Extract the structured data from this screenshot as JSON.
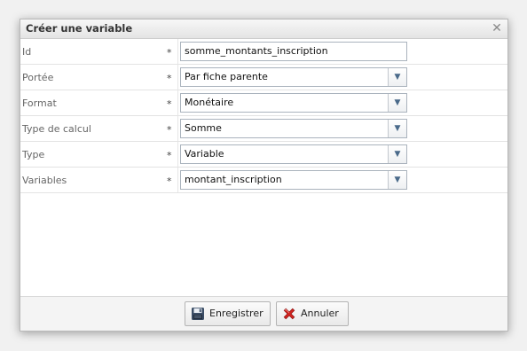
{
  "dialog": {
    "title": "Créer une variable",
    "close_glyph": "✕"
  },
  "form": {
    "required_marker": "*",
    "rows": [
      {
        "label": "Id",
        "type": "text",
        "value": "somme_montants_inscription"
      },
      {
        "label": "Portée",
        "type": "select",
        "value": "Par fiche parente"
      },
      {
        "label": "Format",
        "type": "select",
        "value": "Monétaire"
      },
      {
        "label": "Type de calcul",
        "type": "select",
        "value": "Somme"
      },
      {
        "label": "Type",
        "type": "select",
        "value": "Variable"
      },
      {
        "label": "Variables",
        "type": "select",
        "value": "montant_inscription"
      }
    ],
    "select_arrow_glyph": "▼"
  },
  "footer": {
    "save_label": "Enregistrer",
    "save_icon": "floppy-disk-icon",
    "cancel_label": "Annuler",
    "cancel_icon": "red-x-icon"
  },
  "colors": {
    "dialog_bg": "#ffffff",
    "field_border": "#aab3bd",
    "cancel_icon": "#d2231f"
  }
}
